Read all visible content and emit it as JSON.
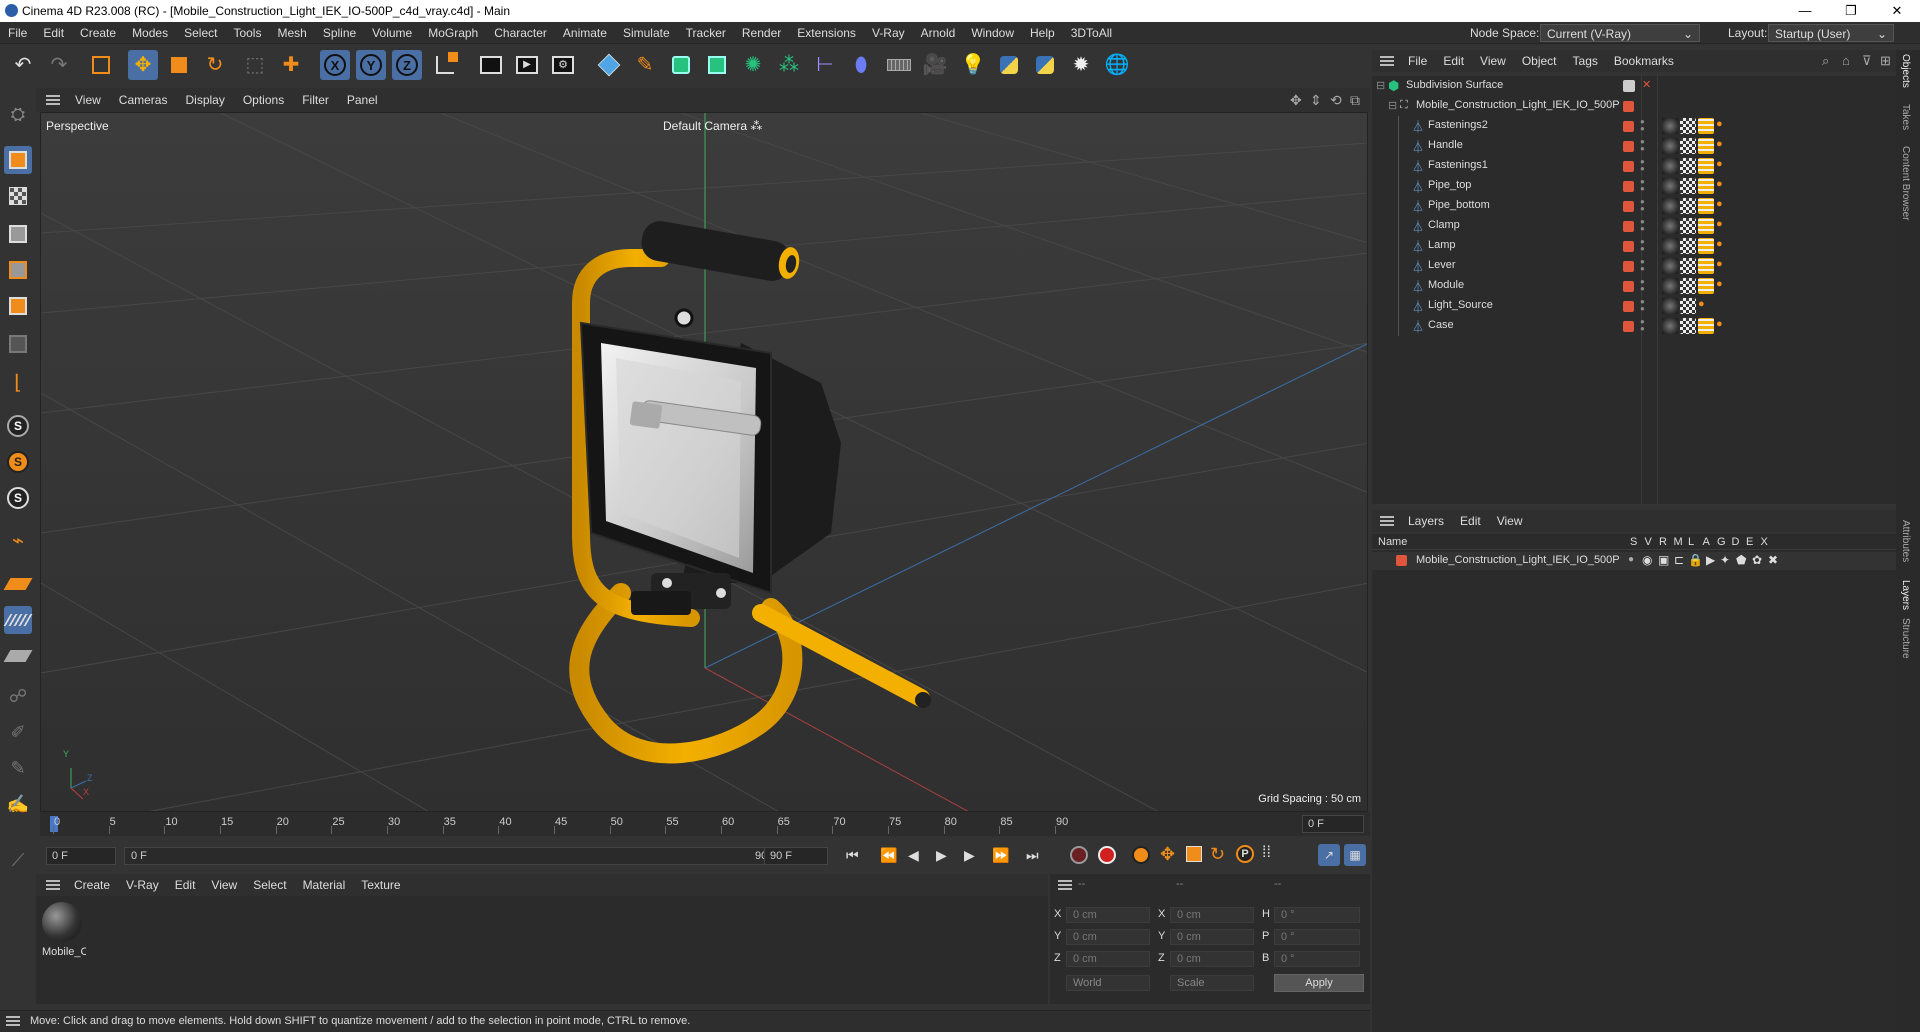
{
  "window": {
    "title": "Cinema 4D R23.008 (RC) - [Mobile_Construction_Light_IEK_IO-500P_c4d_vray.c4d] - Main",
    "controls": [
      "—",
      "❐",
      "✕"
    ]
  },
  "menubar": {
    "items": [
      "File",
      "Edit",
      "Create",
      "Modes",
      "Select",
      "Tools",
      "Mesh",
      "Spline",
      "Volume",
      "MoGraph",
      "Character",
      "Animate",
      "Simulate",
      "Tracker",
      "Render",
      "Extensions",
      "V-Ray",
      "Arnold",
      "Window",
      "Help",
      "3DToAll"
    ],
    "node_space_label": "Node Space:",
    "node_space_value": "Current (V-Ray)",
    "layout_label": "Layout:",
    "layout_value": "Startup (User)"
  },
  "toolbar": {
    "axis_x": "X",
    "axis_y": "Y",
    "axis_z": "Z"
  },
  "viewport": {
    "menu": [
      "View",
      "Cameras",
      "Display",
      "Options",
      "Filter",
      "Panel"
    ],
    "projection_label": "Perspective",
    "camera_label": "Default Camera",
    "grid_spacing": "Grid Spacing : 50 cm",
    "axis_y": "Y",
    "axis_z": "Z",
    "axis_x": "X"
  },
  "timeline": {
    "ticks": [
      "0",
      "5",
      "10",
      "15",
      "20",
      "25",
      "30",
      "35",
      "40",
      "45",
      "50",
      "55",
      "60",
      "65",
      "70",
      "75",
      "80",
      "85",
      "90"
    ],
    "current_frame_right": "0 F",
    "start_frame": "0 F",
    "range_start": "0 F",
    "range_end": "90 F",
    "end_frame": "90 F"
  },
  "materials": {
    "menu": [
      "Create",
      "V-Ray",
      "Edit",
      "View",
      "Select",
      "Material",
      "Texture"
    ],
    "items": [
      {
        "label": "Mobile_C"
      }
    ]
  },
  "coordinates": {
    "headers": [
      "--",
      "--",
      "--"
    ],
    "rows": [
      {
        "l1": "X",
        "v1": "0 cm",
        "l2": "X",
        "v2": "0 cm",
        "l3": "H",
        "v3": "0 °"
      },
      {
        "l1": "Y",
        "v1": "0 cm",
        "l2": "Y",
        "v2": "0 cm",
        "l3": "P",
        "v3": "0 °"
      },
      {
        "l1": "Z",
        "v1": "0 cm",
        "l2": "Z",
        "v2": "0 cm",
        "l3": "B",
        "v3": "0 °"
      }
    ],
    "space": "World",
    "mode": "Scale",
    "apply": "Apply"
  },
  "status": {
    "text": "Move: Click and drag to move elements. Hold down SHIFT to quantize movement / add to the selection in point mode, CTRL to remove."
  },
  "objects": {
    "menu": [
      "File",
      "Edit",
      "View",
      "Object",
      "Tags",
      "Bookmarks"
    ],
    "root": "Subdivision Surface",
    "group": "Mobile_Construction_Light_IEK_IO_500P",
    "children": [
      "Fastenings2",
      "Handle",
      "Fastenings1",
      "Pipe_top",
      "Pipe_bottom",
      "Clamp",
      "Lamp",
      "Lever",
      "Module",
      "Light_Source",
      "Case"
    ]
  },
  "layers": {
    "menu": [
      "Layers",
      "Edit",
      "View"
    ],
    "columns": {
      "name": "Name",
      "flags": [
        "S",
        "V",
        "R",
        "M",
        "L",
        "A",
        "G",
        "D",
        "E",
        "X"
      ]
    },
    "rows": [
      {
        "name": "Mobile_Construction_Light_IEK_IO_500P",
        "color": "#e0563c"
      }
    ]
  },
  "side_tabs": [
    "Objects",
    "Takes",
    "Content Browser",
    "Attributes",
    "Layers",
    "Structure"
  ],
  "colors": {
    "accent": "#4a6fa5",
    "layer_swatch": "#e0563c",
    "lamp_yellow": "#f4b000"
  }
}
